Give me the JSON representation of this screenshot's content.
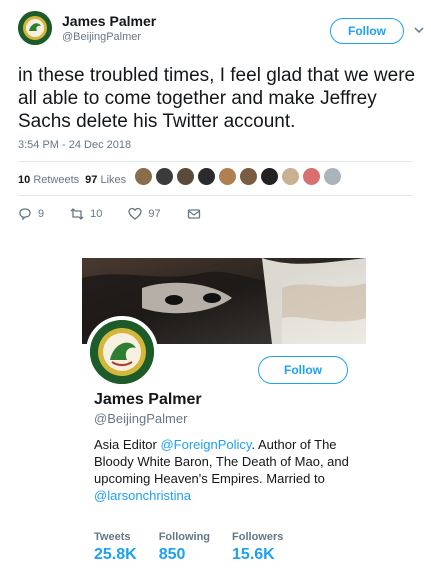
{
  "tweet": {
    "author_name": "James Palmer",
    "author_handle": "@BeijingPalmer",
    "follow_label": "Follow",
    "text": "in these troubled times, I feel glad that we were all able to come together and make Jeffrey Sachs delete his Twitter account.",
    "timestamp": "3:54 PM - 24 Dec 2018",
    "retweets_count": "10",
    "retweets_label": "Retweets",
    "likes_count": "97",
    "likes_label": "Likes",
    "actions": {
      "reply_count": "9",
      "retweet_count": "10",
      "like_count": "97"
    }
  },
  "profile_card": {
    "name": "James Palmer",
    "handle": "@BeijingPalmer",
    "follow_label": "Follow",
    "bio_prefix": "Asia Editor ",
    "bio_link1": "@ForeignPolicy",
    "bio_middle": ". Author of The Bloody White Baron, The Death of Mao, and upcoming Heaven's Empires. Married to ",
    "bio_link2": "@larsonchristina",
    "stats": [
      {
        "label": "Tweets",
        "value": "25.8K"
      },
      {
        "label": "Following",
        "value": "850"
      },
      {
        "label": "Followers",
        "value": "15.6K"
      }
    ]
  },
  "colors": {
    "accent": "#1da1f2",
    "text": "#14171a",
    "muted": "#657786"
  }
}
